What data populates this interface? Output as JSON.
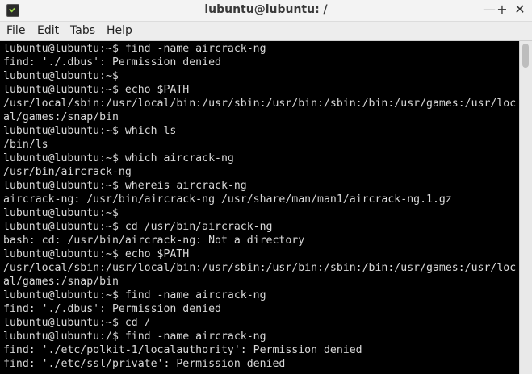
{
  "window": {
    "title": "lubuntu@lubuntu: /",
    "icon": "terminal-icon",
    "controls": {
      "minimize": "—",
      "maximize": "+",
      "close": "✕"
    }
  },
  "menu": [
    "File",
    "Edit",
    "Tabs",
    "Help"
  ],
  "terminal": {
    "background": "#000000",
    "foreground": "#d8d8d8",
    "lines": [
      "lubuntu@lubuntu:~$ find -name aircrack-ng",
      "find: './.dbus': Permission denied",
      "lubuntu@lubuntu:~$",
      "lubuntu@lubuntu:~$ echo $PATH",
      "/usr/local/sbin:/usr/local/bin:/usr/sbin:/usr/bin:/sbin:/bin:/usr/games:/usr/loc",
      "al/games:/snap/bin",
      "lubuntu@lubuntu:~$ which ls",
      "/bin/ls",
      "lubuntu@lubuntu:~$ which aircrack-ng",
      "/usr/bin/aircrack-ng",
      "lubuntu@lubuntu:~$ whereis aircrack-ng",
      "aircrack-ng: /usr/bin/aircrack-ng /usr/share/man/man1/aircrack-ng.1.gz",
      "lubuntu@lubuntu:~$",
      "lubuntu@lubuntu:~$ cd /usr/bin/aircrack-ng",
      "bash: cd: /usr/bin/aircrack-ng: Not a directory",
      "lubuntu@lubuntu:~$ echo $PATH",
      "/usr/local/sbin:/usr/local/bin:/usr/sbin:/usr/bin:/sbin:/bin:/usr/games:/usr/loc",
      "al/games:/snap/bin",
      "lubuntu@lubuntu:~$ find -name aircrack-ng",
      "find: './.dbus': Permission denied",
      "lubuntu@lubuntu:~$ cd /",
      "lubuntu@lubuntu:/$ find -name aircrack-ng",
      "find: './etc/polkit-1/localauthority': Permission denied",
      "find: './etc/ssl/private': Permission denied"
    ]
  }
}
